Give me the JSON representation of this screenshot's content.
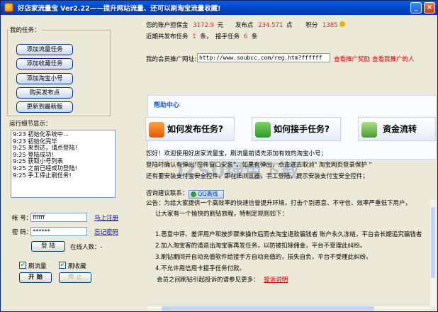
{
  "window": {
    "title": "好店家流量宝 Ver2.22——提升网站流量、还可以刷淘宝流量收藏!",
    "minimize_label": "_",
    "close_label": "×"
  },
  "tasks_panel": {
    "legend": "我的任务：",
    "buttons": [
      {
        "label": "添加流量任务"
      },
      {
        "label": "添加收藏任务"
      },
      {
        "label": "添加淘宝小号"
      },
      {
        "label": "购买发布点"
      },
      {
        "label": "更新到最新版"
      }
    ]
  },
  "log": {
    "label": "运行细节显示：",
    "lines": [
      "9:23 初始化系统中...",
      "9:23 初始化完毕",
      "9:25 来到达，请点登陆!",
      "9:25 登陆成功!",
      "9:25 获取小号列表",
      "9:25 之前已经成功登陆!",
      "9:25 手工停止刷任务!"
    ]
  },
  "login": {
    "account_label": "帐 号：",
    "account_value": "ffffff",
    "register_link": "马上注册",
    "password_label": "密 码：",
    "password_value": "******",
    "forgot_link": "忘记密码",
    "login_button": "登 陆",
    "online_label": "在线人数：-"
  },
  "options": {
    "brush_traffic": {
      "label": "刷流量",
      "checked": true
    },
    "brush_favorites": {
      "label": "刷收藏",
      "checked": true
    },
    "start_button": "开 始",
    "stop_button": "停 止"
  },
  "account_stats": {
    "deposit_label": "您的账户担保金",
    "deposit_value": "3172.9",
    "deposit_unit": "元",
    "points_label": "发布点",
    "points_value": "234.571",
    "points_unit": "点",
    "score_label": "积分",
    "score_value": "1385",
    "published_prefix": "近期共发布任务",
    "published_value": "1",
    "published_unit": "条，",
    "received_prefix": "接手任务",
    "received_value": "6",
    "received_unit": "条"
  },
  "promo": {
    "label": "我的会员推广网址:",
    "url": "http://www.soubcc.com/reg.htm?ffffff",
    "view_reward_link": "查看推广奖励",
    "view_referrals_link": "查看我推广的人"
  },
  "help_center": {
    "title": "帮助中心",
    "buttons": [
      {
        "label": "如何发布任务?",
        "icon": "rss-icon"
      },
      {
        "label": "如何接手任务?",
        "icon": "download-arrow-icon"
      },
      {
        "label": "资金流转",
        "icon": "money-icon"
      }
    ]
  },
  "notices": {
    "line1": "您好！欢迎使用好店家流量宝，刷流量前请先添加有效的淘宝小号；",
    "line2": "登陆时确认有弹出\"控件窗口安装\"，如果有弹出，点击进去取消\" 淘宝网页登录保护 \"",
    "line3": "还有要安装支付宝安全控件，即在IE浏览器，手工登陆，提示安装支付宝安全控件；",
    "line4_label": "咨询建议联系：",
    "qq_label": "QQ离线",
    "line5": "公告：为给大家提供一个高效率的快速信誉提升环境，打击个别恶意、不守信、效率严重低下用户，",
    "line6": "让大家有一个愉快的刷钻旅程，特制定规则如下：",
    "rule1": "1.恶意中评、差评用户和按步骤来操作后而去淘宝退款骗钱者 账户永久冻结，平台会长期追究骗钱者",
    "rule2": "2.加入淘宝客的请退出淘宝客再发任务，以防被扣除佣金，平台不受理此纠纷。",
    "rule3": "3.刷钻期间开自动充值软件给接手方自动充值的，损失自负，平台不受理此纠纷。",
    "rule4": "4.不允许用信用卡接手任务付款。",
    "complaint_text": "会员之间刷钻引起投诉的请参见更多：",
    "complaint_link": "投诉说明"
  },
  "colors": {
    "title_bar": "#0247c9",
    "accent_red": "#cc0000",
    "link_blue": "#0000cc",
    "help_title": "#1a5ccc"
  }
}
